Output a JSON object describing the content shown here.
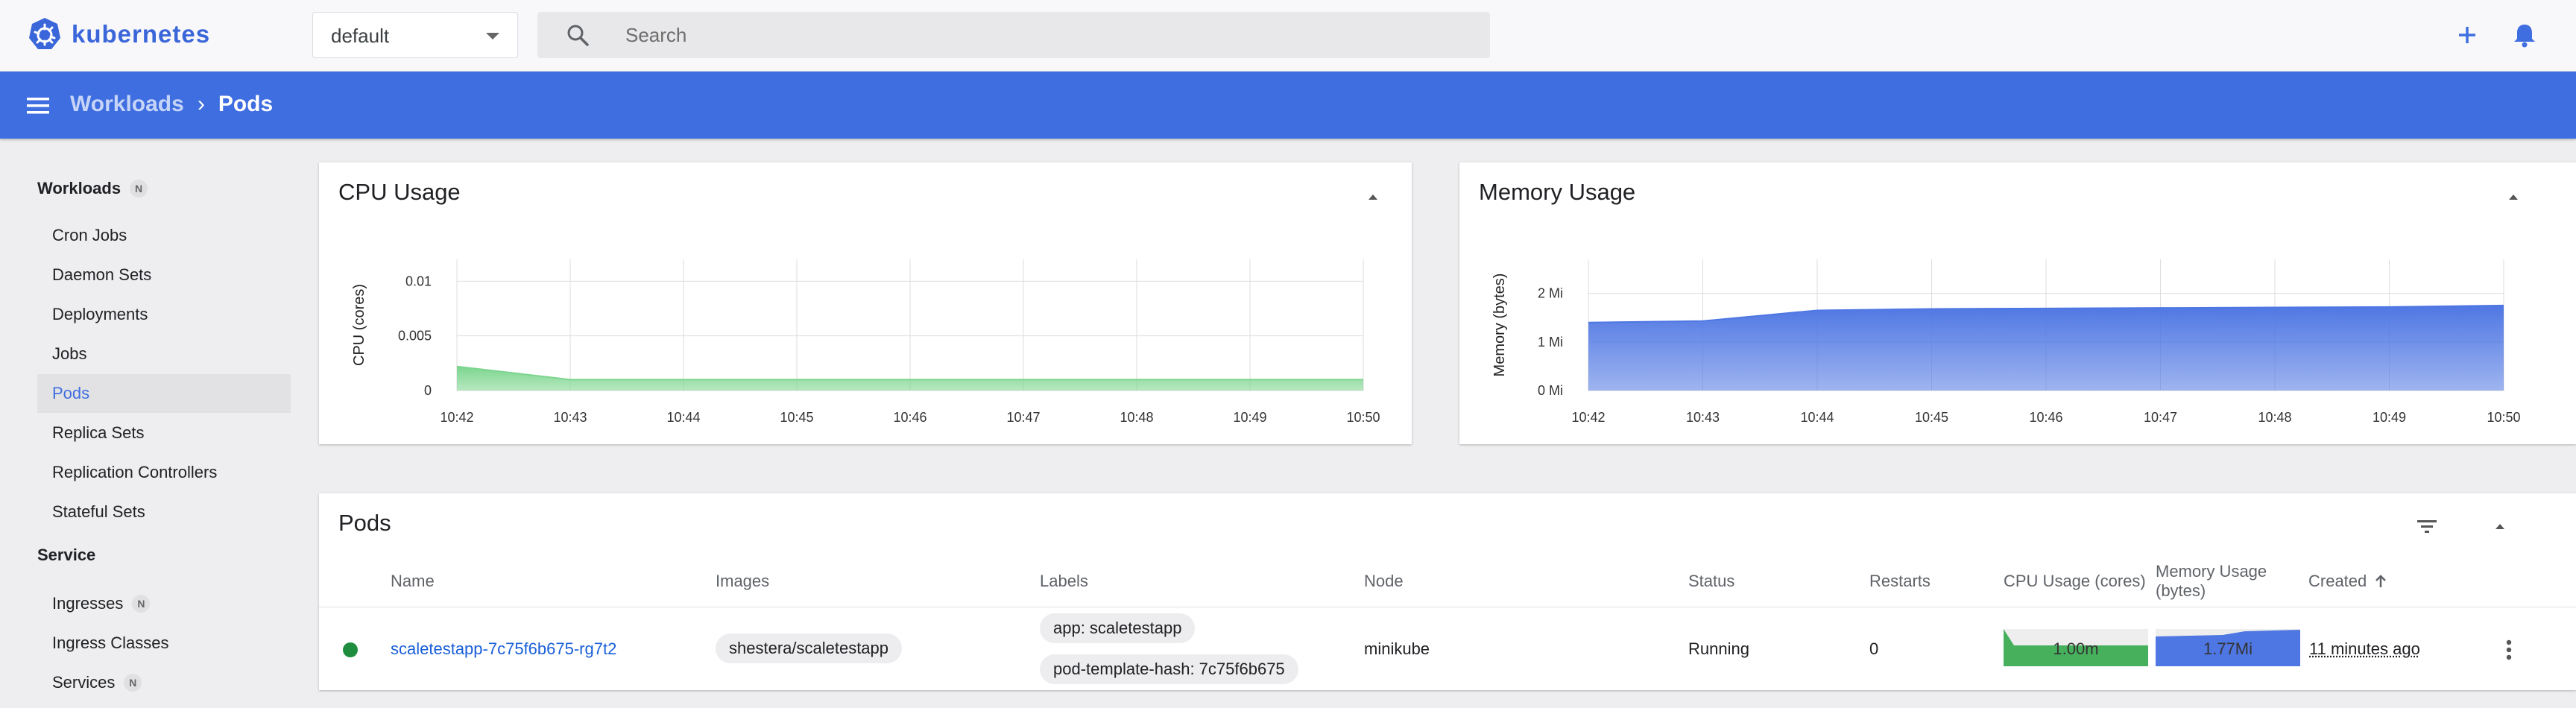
{
  "app": {
    "name": "kubernetes"
  },
  "namespace": {
    "value": "default"
  },
  "search": {
    "placeholder": "Search"
  },
  "breadcrumb": {
    "parent": "Workloads",
    "separator": "›",
    "current": "Pods"
  },
  "sidebar": {
    "sections": [
      {
        "label": "Workloads",
        "badge": "N"
      },
      {
        "label": "Service"
      }
    ],
    "workloads": [
      "Cron Jobs",
      "Daemon Sets",
      "Deployments",
      "Jobs",
      "Pods",
      "Replica Sets",
      "Replication Controllers",
      "Stateful Sets"
    ],
    "service": [
      {
        "label": "Ingresses",
        "badge": "N"
      },
      {
        "label": "Ingress Classes"
      },
      {
        "label": "Services",
        "badge": "N"
      }
    ],
    "active": "Pods"
  },
  "cpu_card": {
    "title": "CPU Usage"
  },
  "memory_card": {
    "title": "Memory Usage"
  },
  "chart_data": [
    {
      "type": "area",
      "title": "CPU Usage",
      "ylabel": "CPU (cores)",
      "x": [
        "10:42",
        "10:43",
        "10:44",
        "10:45",
        "10:46",
        "10:47",
        "10:48",
        "10:49",
        "10:50"
      ],
      "y_ticks": [
        "0",
        "0.005",
        "0.01"
      ],
      "ylim": [
        0,
        0.012
      ],
      "series": [
        {
          "values": [
            0.0022,
            0.001,
            0.001,
            0.001,
            0.001,
            0.001,
            0.001,
            0.001,
            0.001
          ]
        }
      ],
      "color": "#7cd58e",
      "grid": true
    },
    {
      "type": "area",
      "title": "Memory Usage",
      "ylabel": "Memory (bytes)",
      "x": [
        "10:42",
        "10:43",
        "10:44",
        "10:45",
        "10:46",
        "10:47",
        "10:48",
        "10:49",
        "10:50"
      ],
      "y_ticks": [
        "0 Mi",
        "1 Mi",
        "2 Mi"
      ],
      "ylim": [
        0,
        2.7
      ],
      "series": [
        {
          "values": [
            1.4,
            1.43,
            1.65,
            1.68,
            1.69,
            1.7,
            1.71,
            1.72,
            1.75
          ]
        }
      ],
      "color": "#4f77e3",
      "grid": true
    }
  ],
  "pods_card": {
    "title": "Pods",
    "columns": [
      "Name",
      "Images",
      "Labels",
      "Node",
      "Status",
      "Restarts",
      "CPU Usage (cores)",
      "Memory Usage (bytes)",
      "Created"
    ],
    "rows": [
      {
        "name": "scaletestapp-7c75f6b675-rg7t2",
        "image": "shestera/scaletestapp",
        "labels": [
          "app: scaletestapp",
          "pod-template-hash: 7c75f6b675"
        ],
        "node": "minikube",
        "status": "Running",
        "restarts": "0",
        "cpu": "1.00m",
        "memory": "1.77Mi",
        "created": "11 minutes ago"
      }
    ]
  },
  "colors": {
    "accent": "#3f6ee0",
    "running": "#1e8e3e",
    "cpu": "#7cd58e",
    "memory": "#4f77e3"
  }
}
